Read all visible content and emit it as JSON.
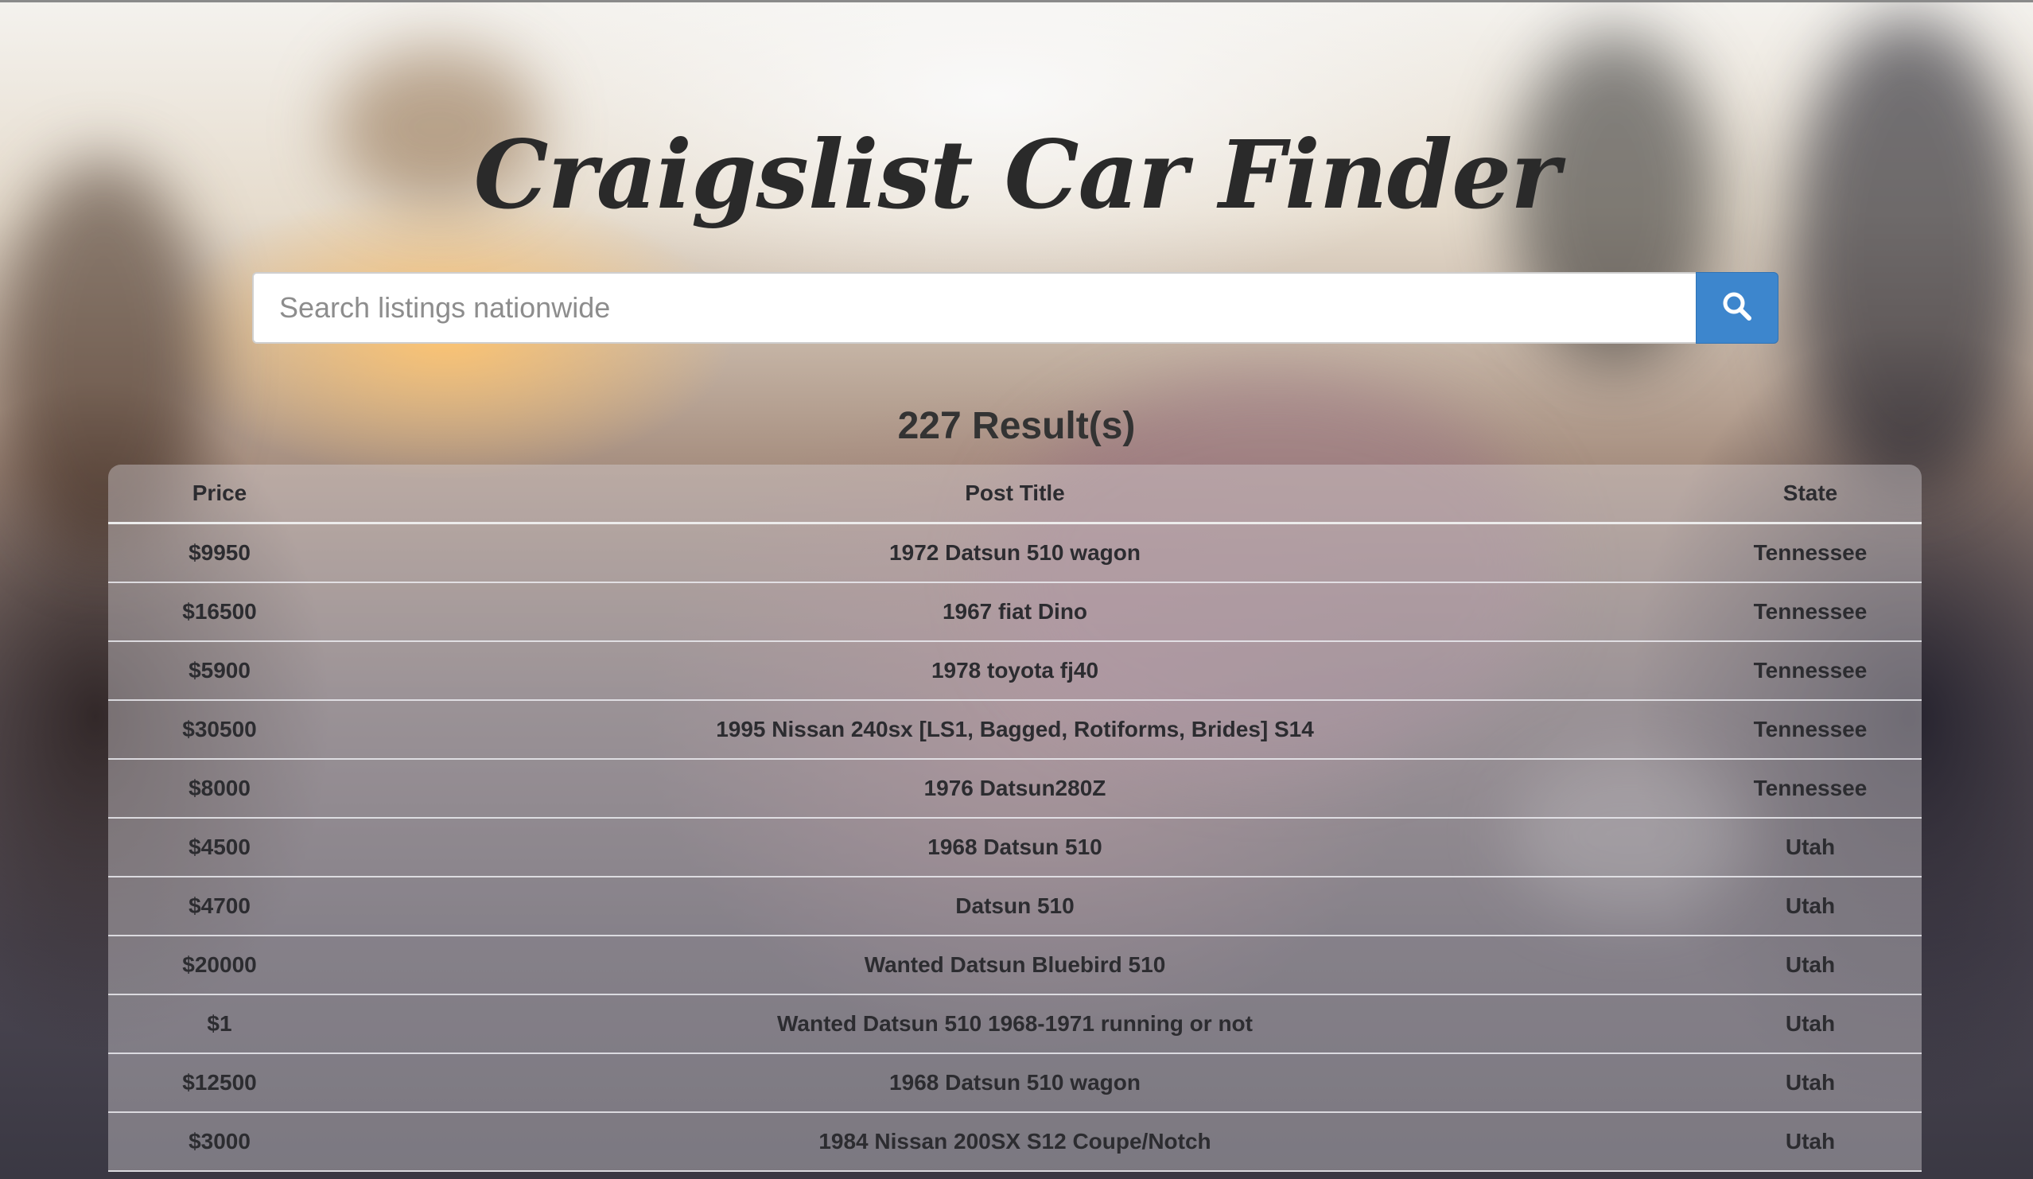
{
  "header": {
    "title": "Craigslist Car Finder"
  },
  "search": {
    "placeholder": "Search listings nationwide",
    "value": ""
  },
  "results": {
    "count_label": "227 Result(s)"
  },
  "table": {
    "columns": [
      "Price",
      "Post Title",
      "State"
    ],
    "rows": [
      {
        "price": "$9950",
        "title": "1972 Datsun 510 wagon",
        "state": "Tennessee"
      },
      {
        "price": "$16500",
        "title": "1967 fiat Dino",
        "state": "Tennessee"
      },
      {
        "price": "$5900",
        "title": "1978 toyota fj40",
        "state": "Tennessee"
      },
      {
        "price": "$30500",
        "title": "1995 Nissan 240sx [LS1, Bagged, Rotiforms, Brides] S14",
        "state": "Tennessee"
      },
      {
        "price": "$8000",
        "title": "1976 Datsun280Z",
        "state": "Tennessee"
      },
      {
        "price": "$4500",
        "title": "1968 Datsun 510",
        "state": "Utah"
      },
      {
        "price": "$4700",
        "title": "Datsun 510",
        "state": "Utah"
      },
      {
        "price": "$20000",
        "title": "Wanted Datsun Bluebird 510",
        "state": "Utah"
      },
      {
        "price": "$1",
        "title": "Wanted Datsun 510 1968-1971 running or not",
        "state": "Utah"
      },
      {
        "price": "$12500",
        "title": "1968 Datsun 510 wagon",
        "state": "Utah"
      },
      {
        "price": "$3000",
        "title": "1984 Nissan 200SX S12 Coupe/Notch",
        "state": "Utah"
      }
    ]
  },
  "colors": {
    "accent": "#3d86cd",
    "title_text": "#2a2a2a"
  },
  "icons": {
    "search_button": "search-icon"
  }
}
